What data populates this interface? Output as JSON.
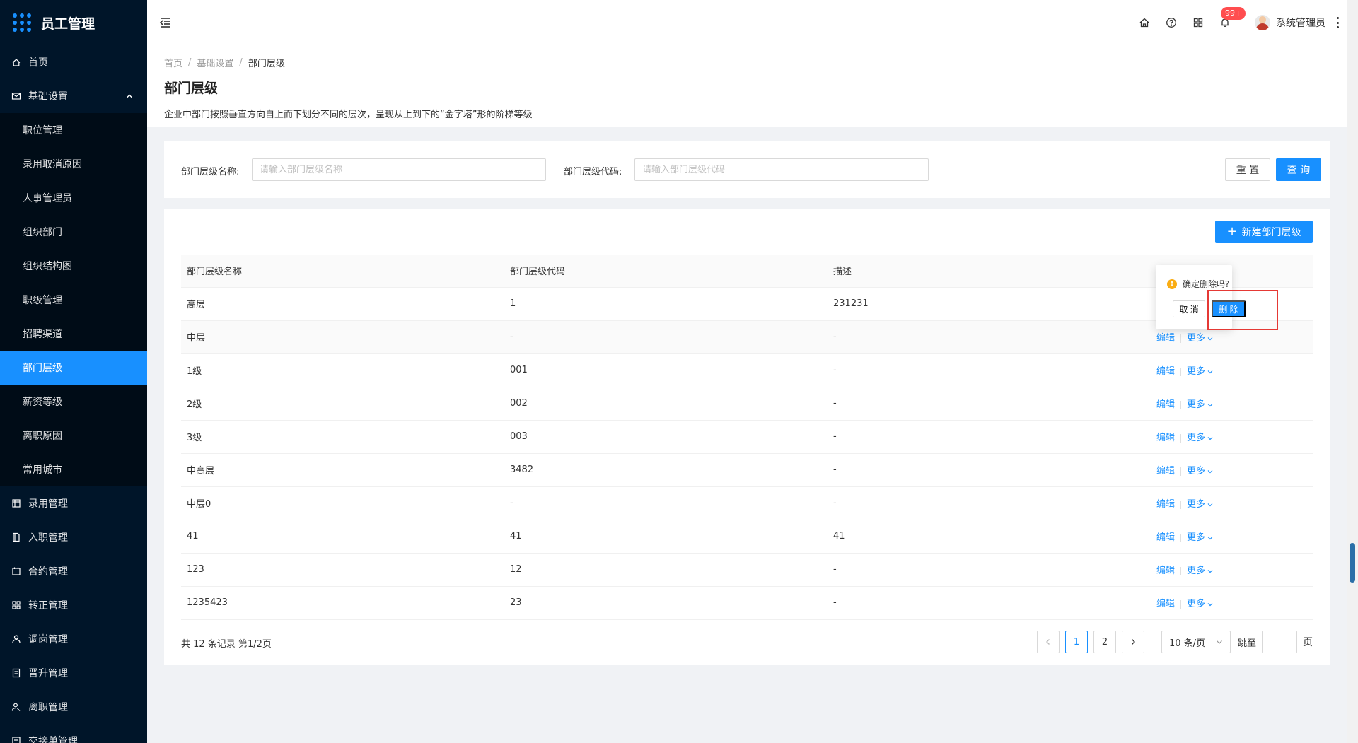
{
  "app": {
    "title": "员工管理"
  },
  "sidebar": {
    "items": [
      {
        "label": "首页",
        "icon": "home-icon"
      },
      {
        "label": "基础设置",
        "icon": "mail-icon",
        "expanded": true,
        "children": [
          {
            "label": "职位管理"
          },
          {
            "label": "录用取消原因"
          },
          {
            "label": "人事管理员"
          },
          {
            "label": "组织部门"
          },
          {
            "label": "组织结构图"
          },
          {
            "label": "职级管理"
          },
          {
            "label": "招聘渠道"
          },
          {
            "label": "部门层级",
            "active": true
          },
          {
            "label": "薪资等级"
          },
          {
            "label": "离职原因"
          },
          {
            "label": "常用城市"
          }
        ]
      },
      {
        "label": "录用管理",
        "icon": "calendar-icon"
      },
      {
        "label": "入职管理",
        "icon": "file-icon"
      },
      {
        "label": "合约管理",
        "icon": "contract-icon"
      },
      {
        "label": "转正管理",
        "icon": "apps-icon"
      },
      {
        "label": "调岗管理",
        "icon": "user-icon"
      },
      {
        "label": "晋升管理",
        "icon": "report-icon"
      },
      {
        "label": "离职管理",
        "icon": "leave-icon"
      },
      {
        "label": "交接单管理",
        "icon": "handover-icon"
      }
    ]
  },
  "header": {
    "badge": "99+",
    "user_name": "系统管理员"
  },
  "breadcrumb": [
    "首页",
    "基础设置",
    "部门层级"
  ],
  "page": {
    "title": "部门层级",
    "description": "企业中部门按照垂直方向自上而下划分不同的层次，呈现从上到下的“金字塔”形的阶梯等级"
  },
  "search": {
    "name_label": "部门层级名称:",
    "name_placeholder": "请输入部门层级名称",
    "code_label": "部门层级代码:",
    "code_placeholder": "请输入部门层级代码",
    "reset_label": "重 置",
    "query_label": "查 询"
  },
  "table": {
    "new_button_label": "新建部门层级",
    "columns": [
      "部门层级名称",
      "部门层级代码",
      "描述",
      ""
    ],
    "edit_label": "编辑",
    "more_label": "更多",
    "rows": [
      {
        "name": "高层",
        "code": "1",
        "desc": "231231"
      },
      {
        "name": "中层",
        "code": "-",
        "desc": "-"
      },
      {
        "name": "1级",
        "code": "001",
        "desc": "-"
      },
      {
        "name": "2级",
        "code": "002",
        "desc": "-"
      },
      {
        "name": "3级",
        "code": "003",
        "desc": "-"
      },
      {
        "name": "中高层",
        "code": "3482",
        "desc": "-"
      },
      {
        "name": "中层0",
        "code": "-",
        "desc": "-"
      },
      {
        "name": "41",
        "code": "41",
        "desc": "41"
      },
      {
        "name": "123",
        "code": "12",
        "desc": "-"
      },
      {
        "name": "1235423",
        "code": "23",
        "desc": "-"
      }
    ]
  },
  "pagination": {
    "total_text": "共 12 条记录 第1/2页",
    "pages": [
      "1",
      "2"
    ],
    "current": "1",
    "page_size": "10 条/页",
    "jump_label": "跳至",
    "page_suffix": "页"
  },
  "popconfirm": {
    "message": "确定删除吗?",
    "cancel_label": "取 消",
    "ok_label": "删 除"
  },
  "colors": {
    "sidebar_bg": "#001529",
    "primary": "#1890ff",
    "highlight_box": "#e53935",
    "warning": "#faad14",
    "badge": "#ff4d4f"
  }
}
